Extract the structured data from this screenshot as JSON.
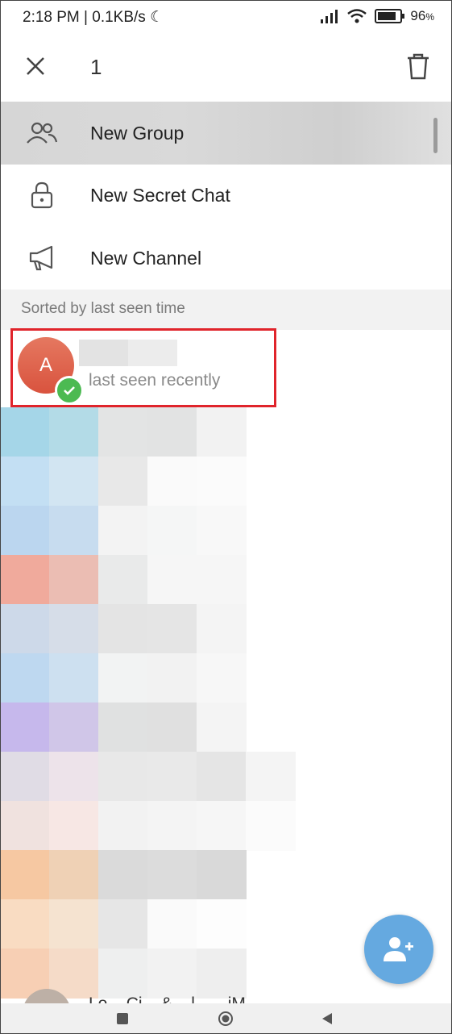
{
  "status_bar": {
    "time": "2:18 PM | 0.1KB/s",
    "battery": "96"
  },
  "action_bar": {
    "selected_count": "1"
  },
  "menu": [
    {
      "label": "New Group",
      "icon": "group-icon"
    },
    {
      "label": "New Secret Chat",
      "icon": "lock-icon"
    },
    {
      "label": "New Channel",
      "icon": "megaphone-icon"
    }
  ],
  "section_header": "Sorted by last seen time",
  "contact": {
    "avatar_letter": "A",
    "status": "last seen recently",
    "avatar_color": "#de6650",
    "check_color": "#4cba52"
  },
  "partial_contact": {
    "name": "Lo... Ci... & ...l... ...iM..."
  },
  "colors": {
    "highlight": "#e0242b",
    "fab": "#65a9e0"
  },
  "pixel_rows": [
    [
      "#a5d6e8",
      "#b3dbe7",
      "#e3e4e4",
      "#e2e3e3",
      "#f2f2f2"
    ],
    [
      "#c3dff3",
      "#d2e5f2",
      "#e8e8e8",
      "#fafafa",
      "#fbfbfb"
    ],
    [
      "#bbd6ef",
      "#c7dcef",
      "#f3f3f3",
      "#f5f6f6",
      "#f8f8f8"
    ],
    [
      "#f0aa9c",
      "#ebbdb3",
      "#e9eaea",
      "#f6f6f6",
      "#f6f6f6"
    ],
    [
      "#cdd9e9",
      "#d6dde8",
      "#e4e4e4",
      "#e5e5e5",
      "#f4f4f4"
    ],
    [
      "#bed8f0",
      "#cde0f0",
      "#f2f3f3",
      "#f2f2f2",
      "#f7f7f7"
    ],
    [
      "#c6b8ec",
      "#d0c6e8",
      "#e0e1e1",
      "#e0e0e0",
      "#f4f4f4"
    ],
    [
      "#e0dce5",
      "#ede3ea",
      "#e8e8e8",
      "#e9e9e9",
      "#e5e5e5",
      "#f4f4f4"
    ],
    [
      "#f0e2df",
      "#f7e7e4",
      "#f2f2f2",
      "#f4f4f4",
      "#f6f6f6",
      "#fbfbfb"
    ],
    [
      "#f6c8a2",
      "#efd1b5",
      "#dadada",
      "#dcdcdc",
      "#d9d9d9"
    ],
    [
      "#f9dcc2",
      "#f5e3d0",
      "#e6e6e6",
      "#fafafa",
      "#fdfdfd"
    ],
    [
      "#f7cfb4",
      "#f5dbc8",
      "#eeefef",
      "#f2f2f2",
      "#eeeeee"
    ]
  ]
}
